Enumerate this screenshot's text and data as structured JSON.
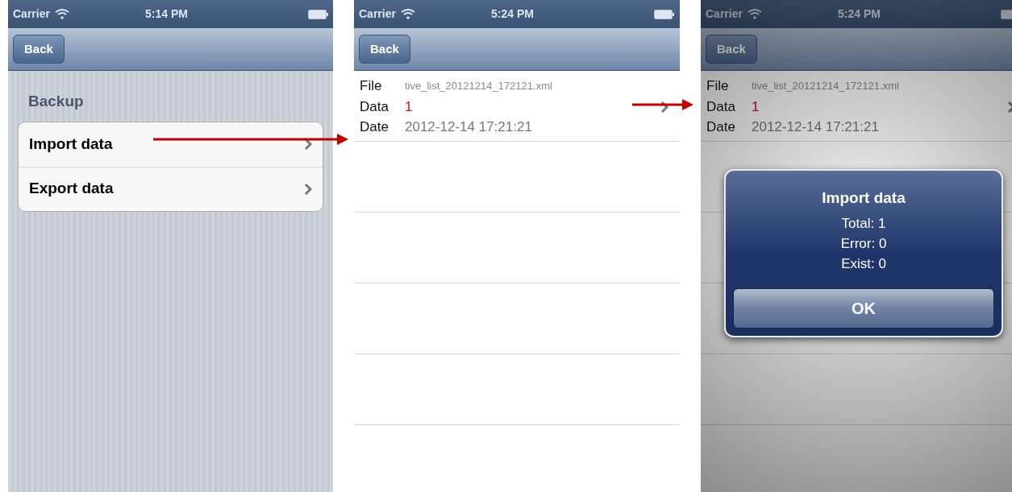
{
  "screens": [
    {
      "kind": "menu",
      "status_bar": {
        "carrier": "Carrier",
        "time": "5:14 PM"
      },
      "nav": {
        "back": "Back"
      },
      "section": "Backup",
      "items": [
        {
          "label": "Import data"
        },
        {
          "label": "Export data"
        }
      ]
    },
    {
      "kind": "detail",
      "status_bar": {
        "carrier": "Carrier",
        "time": "5:24 PM"
      },
      "nav": {
        "back": "Back"
      },
      "fields": [
        {
          "label": "File",
          "value": "tive_list_20121214_172121.xml",
          "kind": "file"
        },
        {
          "label": "Data",
          "value": "1",
          "kind": "count"
        },
        {
          "label": "Date",
          "value": "2012-12-14 17:21:21",
          "kind": "date"
        }
      ]
    },
    {
      "kind": "detail",
      "status_bar": {
        "carrier": "Carrier",
        "time": "5:24 PM"
      },
      "nav": {
        "back": "Back"
      },
      "fields": [
        {
          "label": "File",
          "value": "tive_list_20121214_172121.xml",
          "kind": "file"
        },
        {
          "label": "Data",
          "value": "1",
          "kind": "count"
        },
        {
          "label": "Date",
          "value": "2012-12-14 17:21:21",
          "kind": "date"
        }
      ],
      "alert": {
        "title": "Import data",
        "lines": [
          "Total: 1",
          "Error: 0",
          "Exist: 0"
        ],
        "button": "OK"
      }
    }
  ]
}
